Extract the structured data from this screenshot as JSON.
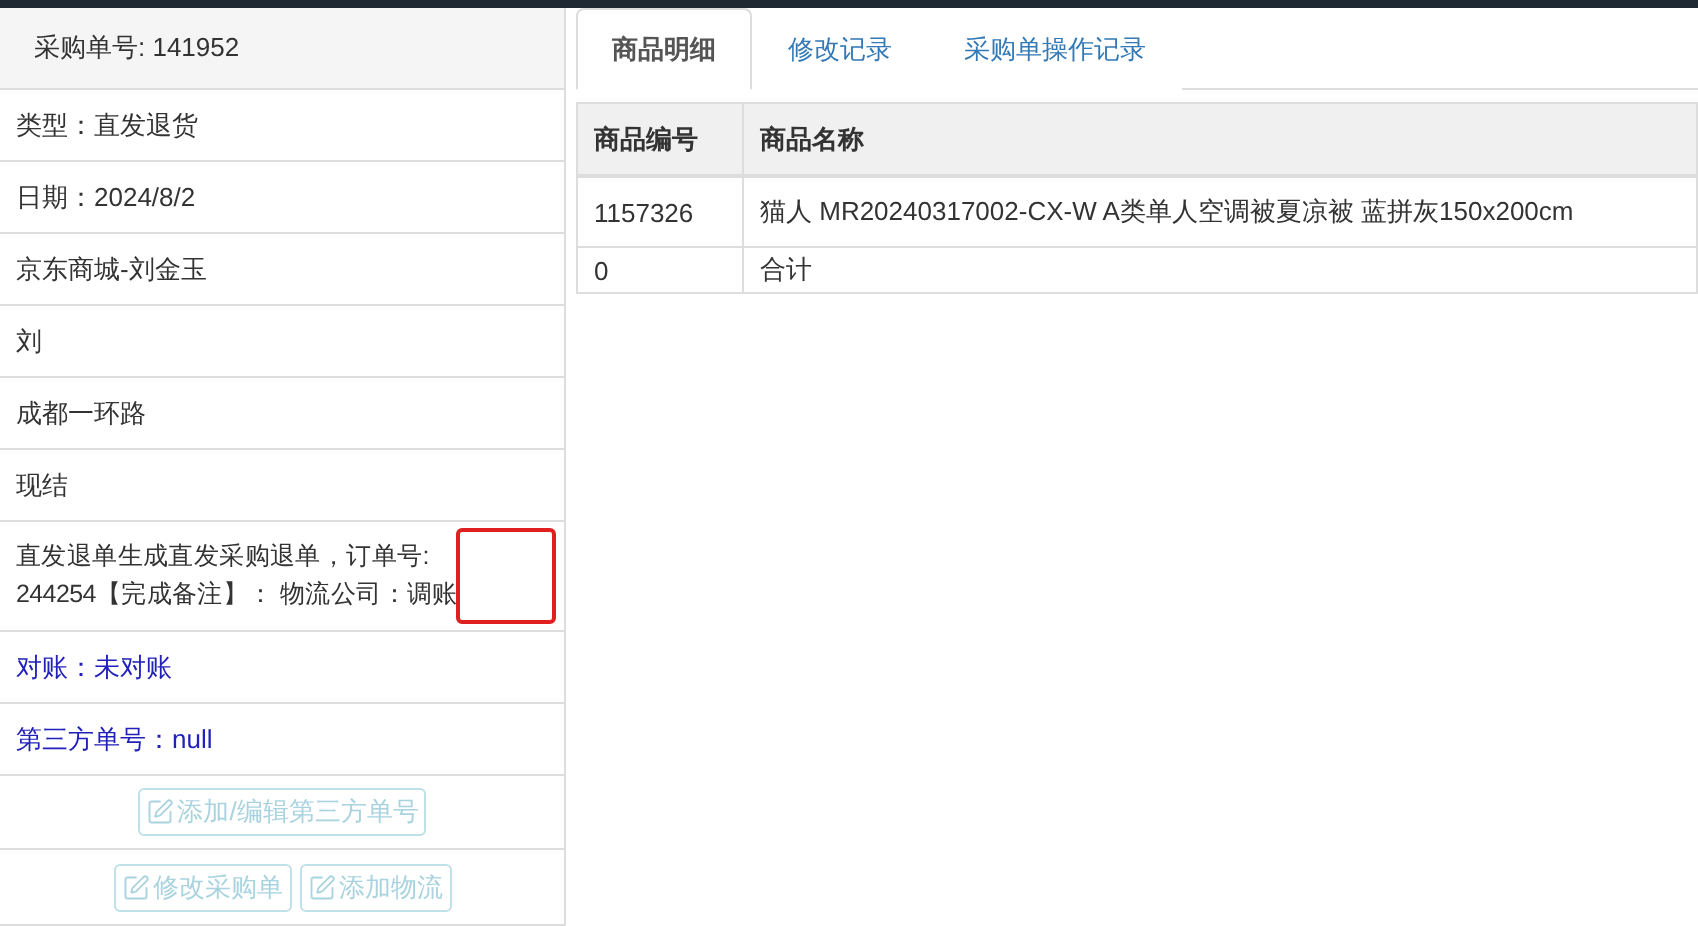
{
  "order_panel": {
    "header": "采购单号: 141952",
    "rows": [
      {
        "text": "类型：直发退货",
        "kind": "plain"
      },
      {
        "text": "日期：2024/8/2",
        "kind": "plain"
      },
      {
        "text": "京东商城-刘金玉",
        "kind": "plain"
      },
      {
        "text": "刘",
        "kind": "plain"
      },
      {
        "text": "成都一环路",
        "kind": "plain"
      },
      {
        "text": "现结",
        "kind": "plain"
      },
      {
        "lines": [
          "直发退单生成直发采购退单，订单号:",
          "244254【完成备注】： 物流公司：调账"
        ],
        "kind": "note",
        "highlighted": true
      },
      {
        "text": "对账：未对账",
        "kind": "link"
      },
      {
        "text": "第三方单号：null",
        "kind": "link"
      }
    ],
    "button_rows": [
      [
        {
          "label": "添加/编辑第三方单号",
          "disabled": true
        }
      ],
      [
        {
          "label": "修改采购单",
          "disabled": true
        },
        {
          "label": "添加物流",
          "disabled": true
        }
      ]
    ]
  },
  "tabs": [
    {
      "label": "商品明细",
      "selected": true
    },
    {
      "label": "修改记录",
      "selected": false
    },
    {
      "label": "采购单操作记录",
      "selected": false
    }
  ],
  "table": {
    "columns": [
      "商品编号",
      "商品名称"
    ],
    "rows": [
      [
        "1157326",
        "猫人 MR20240317002-CX-W A类单人空调被夏凉被 蓝拼灰150x200cm"
      ],
      [
        "0",
        "合计"
      ]
    ]
  }
}
